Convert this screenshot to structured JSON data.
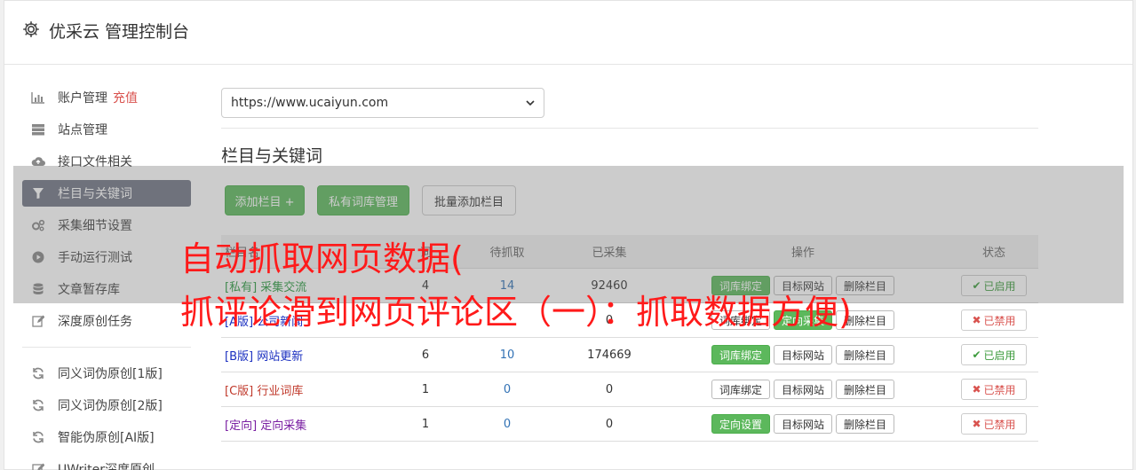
{
  "header": {
    "title": "优采云 管理控制台",
    "icon": "gear-icon"
  },
  "sidebar": {
    "items": [
      {
        "label": "账户管理",
        "extra": "充值",
        "icon": "bar-chart-icon"
      },
      {
        "label": "站点管理",
        "icon": "server-icon"
      },
      {
        "label": "接口文件相关",
        "icon": "cloud-upload-icon"
      },
      {
        "label": "栏目与关键词",
        "icon": "filter-icon",
        "active": true
      },
      {
        "label": "采集细节设置",
        "icon": "cogs-icon"
      },
      {
        "label": "手动运行测试",
        "icon": "play-circle-icon"
      },
      {
        "label": "文章暂存库",
        "icon": "database-icon"
      },
      {
        "label": "深度原创任务",
        "icon": "edit-icon"
      }
    ],
    "items2": [
      {
        "label": "同义词伪原创[1版]",
        "icon": "refresh-icon"
      },
      {
        "label": "同义词伪原创[2版]",
        "icon": "refresh-icon"
      },
      {
        "label": "智能伪原创[AI版]",
        "icon": "refresh-icon"
      },
      {
        "label": "UWriter深度原创",
        "icon": "edit-icon"
      }
    ]
  },
  "main": {
    "site_select": "https://www.ucaiyun.com",
    "section_title": "栏目与关键词",
    "buttons": {
      "add": "添加栏目 +",
      "private": "私有词库管理",
      "batch": "批量添加栏目"
    },
    "table": {
      "headers": {
        "name": "栏目名",
        "kw": "词",
        "wait": "待抓取",
        "done": "已采集",
        "ops": "操作",
        "status": "状态"
      },
      "rows": [
        {
          "name": "[私有] 采集交流",
          "kw": "4",
          "wait": "14",
          "done": "92460",
          "op1": "词库绑定",
          "op2": "目标网站",
          "op3": "删除栏目",
          "status": "已启用",
          "on": true
        },
        {
          "name": "[A版] 公司新闻",
          "kw": "",
          "wait": "",
          "done": "0",
          "op1": "词库绑定",
          "op2": "定向采集",
          "op3": "删除栏目",
          "status": "已禁用",
          "on": false
        },
        {
          "name": "[B版] 网站更新",
          "kw": "6",
          "wait": "10",
          "done": "174669",
          "op1": "词库绑定",
          "op2": "目标网站",
          "op3": "删除栏目",
          "status": "已启用",
          "on": true
        },
        {
          "name": "[C版] 行业词库",
          "kw": "1",
          "wait": "0",
          "done": "0",
          "op1": "词库绑定",
          "op2": "目标网站",
          "op3": "删除栏目",
          "status": "已禁用",
          "on": false
        },
        {
          "name": "[定向] 定向采集",
          "kw": "1",
          "wait": "0",
          "done": "0",
          "op1": "定向设置",
          "op2": "目标网站",
          "op3": "删除栏目",
          "status": "已禁用",
          "on": false
        }
      ]
    }
  },
  "overlay": {
    "line1": "自动抓取网页数据(",
    "line2": "抓评论滑到网页评论区（一）：抓取数据方便)"
  },
  "colors": {
    "accent_green": "#5cb85c",
    "active_nav": "#707684",
    "overlay_text": "#ff1a1a",
    "danger": "#d9534f"
  }
}
